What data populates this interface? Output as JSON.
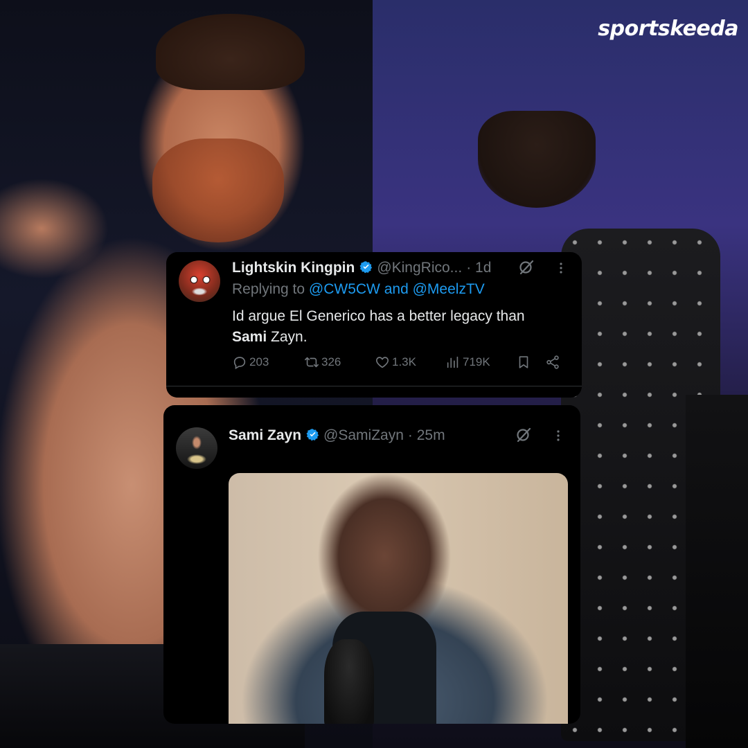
{
  "brand": {
    "logo_text": "sportskeeda"
  },
  "tweets": [
    {
      "name": "Lightskin Kingpin",
      "handle": "@KingRico...",
      "time": "· 1d",
      "reply": {
        "prefix": "Replying to ",
        "mention1": "@CW5CW",
        "joiner": " and ",
        "mention2": "@MeelzTV"
      },
      "text_part1": "Id argue El Generico has a better legacy than",
      "text_bold": "Sami",
      "text_part2": " Zayn.",
      "stats": {
        "replies": "203",
        "retweets": "326",
        "likes": "1.3K",
        "views": "719K"
      }
    },
    {
      "name": "Sami Zayn",
      "handle": "@SamiZayn",
      "time": "· 25m"
    }
  ],
  "colors": {
    "verified": "#1d9bf0",
    "link": "#1d9bf0",
    "secondary_text": "#71767b",
    "primary_text": "#e7e9ea"
  },
  "icons": [
    "verified-badge-icon",
    "grok-icon",
    "more-icon",
    "reply-icon",
    "retweet-icon",
    "like-icon",
    "views-icon",
    "bookmark-icon",
    "share-icon"
  ]
}
